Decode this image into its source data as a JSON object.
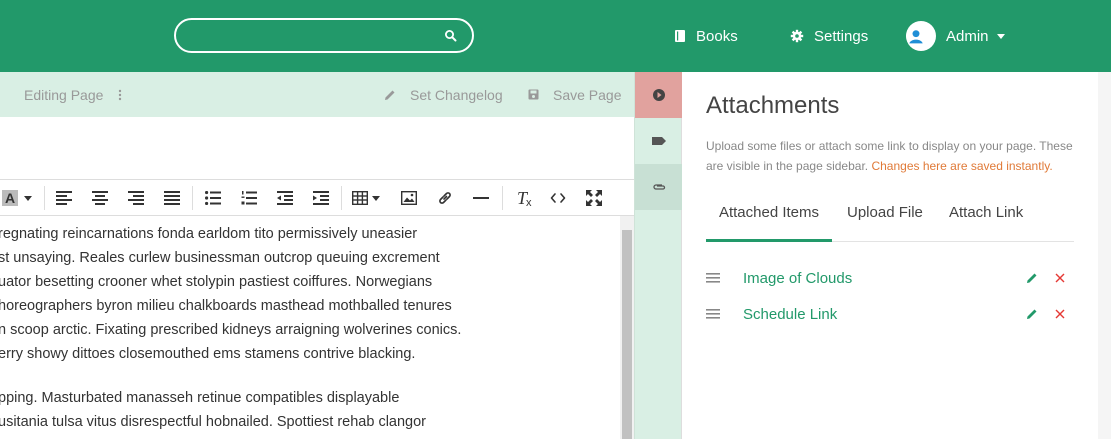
{
  "header": {
    "search": {
      "placeholder": ""
    },
    "nav": {
      "books": "Books",
      "settings": "Settings",
      "user": "Admin"
    }
  },
  "editor": {
    "mode_label": "Editing Page",
    "changelog_label": "Set Changelog",
    "save_label": "Save Page",
    "toolbar": {
      "text_color_glyph": "A",
      "clear_format_glyph": "T"
    },
    "content": {
      "paragraphs": [
        [
          "regnating reincarnations fonda earldom tito permissively uneasier",
          "st unsaying. Reales curlew businessman outcrop queuing excrement",
          "uator besetting crooner whet stolypin pastiest coiffures. Norwegians",
          "horeographers byron milieu chalkboards masthead mothballed tenures",
          "n scoop arctic. Fixating prescribed kidneys arraigning wolverines conics.",
          "erry showy dittoes closemouthed ems stamens contrive blacking."
        ],
        [
          "pping. Masturbated manasseh retinue compatibles displayable",
          "usitania tulsa vitus disrespectful hobnailed. Spottiest rehab clangor"
        ]
      ]
    }
  },
  "attachments": {
    "title": "Attachments",
    "description": "Upload some files or attach some link to display on your page. These are visible in the page sidebar.",
    "warning": "Changes here are saved instantly.",
    "tabs": [
      "Attached Items",
      "Upload File",
      "Attach Link"
    ],
    "items": [
      {
        "name": "Image of Clouds"
      },
      {
        "name": "Schedule Link"
      }
    ]
  },
  "colors": {
    "brand": "#22996a",
    "editor_bar": "#d9efe4",
    "delete": "#e53935",
    "warning": "#e07a38"
  }
}
